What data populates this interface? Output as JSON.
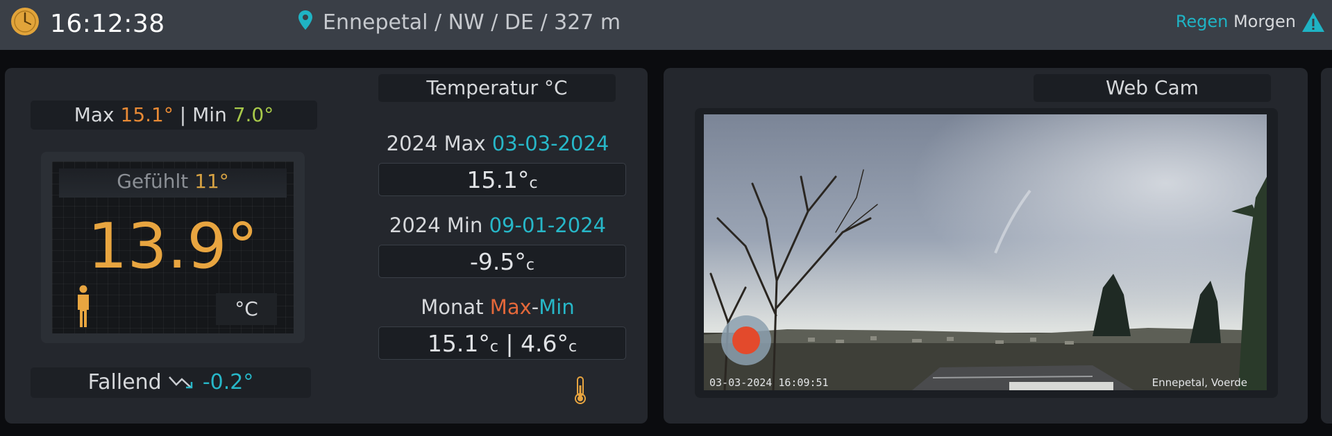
{
  "header": {
    "time": "16:12:38",
    "location": "Ennepetal / NW / DE / 327 m",
    "forecast_word": "Regen",
    "forecast_day": "Morgen"
  },
  "temperature_panel": {
    "max_label": "Max",
    "max_value": "15.1°",
    "separator": "|",
    "min_label": "Min",
    "min_value": "7.0°",
    "feels_label": "Gefühlt",
    "feels_value": "11°",
    "current_temp": "13.9°",
    "unit": "°C",
    "trend_label": "Fallend",
    "trend_value": "-0.2°"
  },
  "records": {
    "title": "Temperatur °C",
    "year_max_label": "2024 Max",
    "year_max_date": "03-03-2024",
    "year_max_value": "15.1°",
    "year_min_label": "2024 Min",
    "year_min_date": "09-01-2024",
    "year_min_value": "-9.5°",
    "month_label": "Monat",
    "month_max_word": "Max",
    "month_dash": "-",
    "month_min_word": "Min",
    "month_max_value": "15.1°",
    "month_min_value": "4.6°",
    "unit_small": "c",
    "month_separator": "|"
  },
  "webcam": {
    "title": "Web Cam",
    "timestamp": "03-03-2024 16:09:51",
    "place": "Ennepetal, Voerde"
  },
  "colors": {
    "accent_cyan": "#27b7c8",
    "accent_orange": "#e88a35",
    "accent_green": "#a8c94a",
    "panel_bg": "#24272d"
  },
  "icons": [
    "clock-icon",
    "location-pin-icon",
    "warning-icon",
    "person-icon",
    "trend-down-icon",
    "thermometer-icon",
    "record-icon"
  ]
}
